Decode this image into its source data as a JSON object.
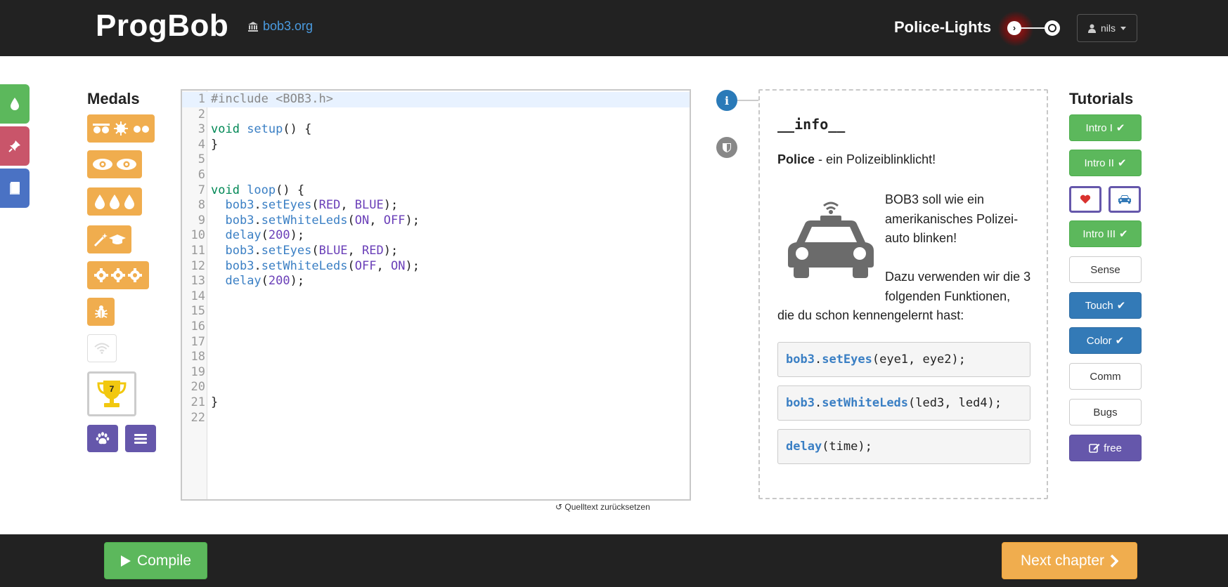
{
  "header": {
    "logo": "ProgBob",
    "site_link": "bob3.org",
    "site_icon": "bank-icon",
    "lesson_title": "Police-Lights",
    "progress_current_icon": "chevron-right-icon",
    "progress_next_icon": "circle-icon",
    "user_name": "nils",
    "user_icon": "user-icon",
    "caret_icon": "caret-down-icon"
  },
  "side_tabs": [
    {
      "icon": "drop-icon",
      "color": "#5cb85c"
    },
    {
      "icon": "pushpin-icon",
      "color": "#c9556a"
    },
    {
      "icon": "book-icon",
      "color": "#4a72c4"
    }
  ],
  "medals": {
    "title": "Medals",
    "items": [
      {
        "icon": "leds-sun-icon",
        "earned": true
      },
      {
        "icon": "eyes-icon",
        "earned": true
      },
      {
        "icon": "drops-icon",
        "earned": true
      },
      {
        "icon": "magic-graduation-icon",
        "earned": true
      },
      {
        "icon": "gears-icon",
        "earned": true
      },
      {
        "icon": "bug-icon",
        "earned": true
      },
      {
        "icon": "wifi-icon",
        "earned": false
      }
    ],
    "trophy_count": "7",
    "trophy_icon": "trophy-icon",
    "paw_icon": "paw-icon",
    "menu_icon": "menu-icon",
    "colors": {
      "medal": "#f0ad4e",
      "purple": "#6557ab"
    }
  },
  "editor": {
    "lines": [
      {
        "n": "1",
        "tokens": [
          {
            "c": "cm",
            "t": "#include <BOB3.h>"
          }
        ]
      },
      {
        "n": "2",
        "tokens": []
      },
      {
        "n": "3",
        "tokens": [
          {
            "c": "kw",
            "t": "void "
          },
          {
            "c": "fn",
            "t": "setup"
          },
          {
            "c": "",
            "t": "() {"
          }
        ]
      },
      {
        "n": "4",
        "tokens": [
          {
            "c": "",
            "t": "}"
          }
        ]
      },
      {
        "n": "5",
        "tokens": []
      },
      {
        "n": "6",
        "tokens": []
      },
      {
        "n": "7",
        "tokens": [
          {
            "c": "kw",
            "t": "void "
          },
          {
            "c": "fn",
            "t": "loop"
          },
          {
            "c": "",
            "t": "() {"
          }
        ]
      },
      {
        "n": "8",
        "tokens": [
          {
            "c": "",
            "t": "  "
          },
          {
            "c": "obj",
            "t": "bob3"
          },
          {
            "c": "",
            "t": "."
          },
          {
            "c": "fn",
            "t": "setEyes"
          },
          {
            "c": "",
            "t": "("
          },
          {
            "c": "const",
            "t": "RED"
          },
          {
            "c": "",
            "t": ", "
          },
          {
            "c": "const",
            "t": "BLUE"
          },
          {
            "c": "",
            "t": ");"
          }
        ]
      },
      {
        "n": "9",
        "tokens": [
          {
            "c": "",
            "t": "  "
          },
          {
            "c": "obj",
            "t": "bob3"
          },
          {
            "c": "",
            "t": "."
          },
          {
            "c": "fn",
            "t": "setWhiteLeds"
          },
          {
            "c": "",
            "t": "("
          },
          {
            "c": "const",
            "t": "ON"
          },
          {
            "c": "",
            "t": ", "
          },
          {
            "c": "const",
            "t": "OFF"
          },
          {
            "c": "",
            "t": ");"
          }
        ]
      },
      {
        "n": "10",
        "tokens": [
          {
            "c": "",
            "t": "  "
          },
          {
            "c": "fn",
            "t": "delay"
          },
          {
            "c": "",
            "t": "("
          },
          {
            "c": "num",
            "t": "200"
          },
          {
            "c": "",
            "t": ");"
          }
        ]
      },
      {
        "n": "11",
        "tokens": [
          {
            "c": "",
            "t": "  "
          },
          {
            "c": "obj",
            "t": "bob3"
          },
          {
            "c": "",
            "t": "."
          },
          {
            "c": "fn",
            "t": "setEyes"
          },
          {
            "c": "",
            "t": "("
          },
          {
            "c": "const",
            "t": "BLUE"
          },
          {
            "c": "",
            "t": ", "
          },
          {
            "c": "const",
            "t": "RED"
          },
          {
            "c": "",
            "t": ");"
          }
        ]
      },
      {
        "n": "12",
        "tokens": [
          {
            "c": "",
            "t": "  "
          },
          {
            "c": "obj",
            "t": "bob3"
          },
          {
            "c": "",
            "t": "."
          },
          {
            "c": "fn",
            "t": "setWhiteLeds"
          },
          {
            "c": "",
            "t": "("
          },
          {
            "c": "const",
            "t": "OFF"
          },
          {
            "c": "",
            "t": ", "
          },
          {
            "c": "const",
            "t": "ON"
          },
          {
            "c": "",
            "t": ");"
          }
        ]
      },
      {
        "n": "13",
        "tokens": [
          {
            "c": "",
            "t": "  "
          },
          {
            "c": "fn",
            "t": "delay"
          },
          {
            "c": "",
            "t": "("
          },
          {
            "c": "num",
            "t": "200"
          },
          {
            "c": "",
            "t": ");"
          }
        ]
      },
      {
        "n": "14",
        "tokens": []
      },
      {
        "n": "15",
        "tokens": []
      },
      {
        "n": "16",
        "tokens": []
      },
      {
        "n": "17",
        "tokens": []
      },
      {
        "n": "18",
        "tokens": []
      },
      {
        "n": "19",
        "tokens": []
      },
      {
        "n": "20",
        "tokens": []
      },
      {
        "n": "21",
        "tokens": [
          {
            "c": "",
            "t": "}"
          }
        ]
      },
      {
        "n": "22",
        "tokens": []
      }
    ],
    "active_line": "1",
    "reset_label": "↺ Quelltext zurücksetzen"
  },
  "info": {
    "pin_icon": "info-icon",
    "shield_icon": "shield-icon",
    "heading": "__info__",
    "sub_bold": "Police",
    "sub_rest": " - ein Polizeiblinklicht!",
    "car_icon": "police-car-icon",
    "text1": "BOB3 soll wie ein amerikanisches Polizei-auto blinken!",
    "text2": "Dazu verwenden wir die 3 folgenden Funktionen,",
    "text3": "die du schon kennengelernt hast:",
    "snippets": [
      {
        "obj": "bob3",
        "dot": ".",
        "fn": "setEyes",
        "args": "(eye1, eye2);"
      },
      {
        "obj": "bob3",
        "dot": ".",
        "fn": "setWhiteLeds",
        "args": "(led3, led4);"
      },
      {
        "obj": "",
        "dot": "",
        "fn": "delay",
        "args": "(time);"
      }
    ]
  },
  "tutorials": {
    "title": "Tutorials",
    "buttons": [
      {
        "label": "Intro I",
        "check": "✔",
        "style": "green"
      },
      {
        "label": "Intro II",
        "check": "✔",
        "style": "green"
      },
      {
        "label": "Intro III",
        "check": "✔",
        "style": "green"
      },
      {
        "label": "Sense",
        "check": "",
        "style": "white"
      },
      {
        "label": "Touch",
        "check": "✔",
        "style": "blue"
      },
      {
        "label": "Color",
        "check": "✔",
        "style": "blue"
      },
      {
        "label": "Comm",
        "check": "",
        "style": "white"
      },
      {
        "label": "Bugs",
        "check": "",
        "style": "white"
      },
      {
        "label": "free",
        "check": "",
        "style": "purple",
        "icon": "edit-icon"
      }
    ],
    "small_buttons": [
      {
        "icon": "heart-icon"
      },
      {
        "icon": "car-icon"
      }
    ]
  },
  "footer": {
    "compile_label": "Compile",
    "compile_icon": "play-icon",
    "next_label": "Next chapter",
    "next_icon": "chevron-right-icon"
  }
}
